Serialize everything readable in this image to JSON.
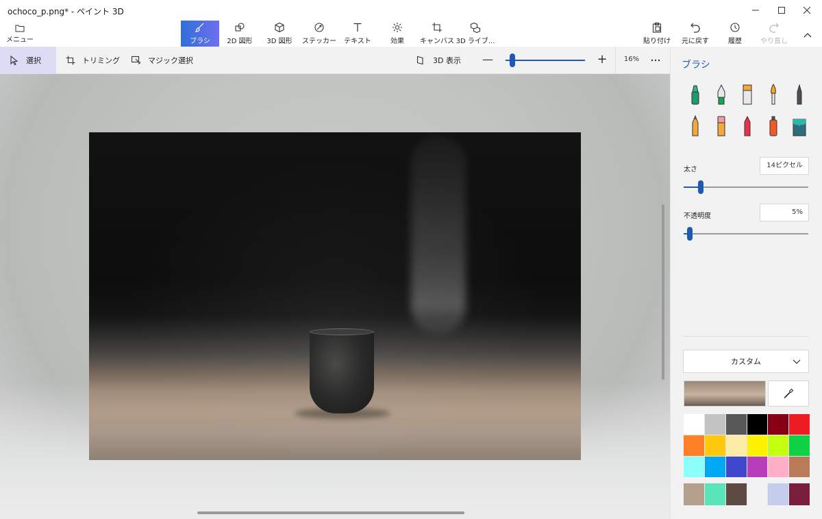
{
  "window": {
    "title": "ochoco_p.png* - ペイント 3D"
  },
  "ribbon": {
    "menu_label": "メニュー",
    "tools": [
      {
        "label": "ブラシ",
        "icon": "brush-icon",
        "active": true
      },
      {
        "label": "2D 図形",
        "icon": "2d-shapes-icon"
      },
      {
        "label": "3D 図形",
        "icon": "3d-shapes-icon"
      },
      {
        "label": "ステッカー",
        "icon": "sticker-icon"
      },
      {
        "label": "テキスト",
        "icon": "text-icon"
      },
      {
        "label": "効果",
        "icon": "effects-icon"
      },
      {
        "label": "キャンバス",
        "icon": "canvas-icon"
      },
      {
        "label": "3D ライブ...",
        "icon": "3d-library-icon"
      }
    ],
    "actions": [
      {
        "label": "貼り付け",
        "icon": "paste-icon"
      },
      {
        "label": "元に戻す",
        "icon": "undo-icon"
      },
      {
        "label": "履歴",
        "icon": "history-icon"
      },
      {
        "label": "やり直し",
        "icon": "redo-icon",
        "disabled": true
      }
    ]
  },
  "subbar": {
    "select_label": "選択",
    "trim_label": "トリミング",
    "magic_label": "マジック選択",
    "view3d_label": "3D 表示",
    "zoom_percent": "16%",
    "zoom_level": 0.05
  },
  "panel": {
    "title": "ブラシ",
    "thickness_label": "太さ",
    "thickness_value": "14ピクセル",
    "thickness_level": 0.14,
    "opacity_label": "不透明度",
    "opacity_value": "5%",
    "opacity_level": 0.05,
    "palette_mode": "カスタム",
    "accent": "#1e5ab3",
    "palette": [
      "#ffffff",
      "#c3c3c3",
      "#585858",
      "#000000",
      "#880015",
      "#ed1c24",
      "#ff7f27",
      "#ffc90e",
      "#fdeca6",
      "#fff200",
      "#c4ff0e",
      "#0ed145",
      "#8cfffb",
      "#00a8f3",
      "#3f48cc",
      "#b83dba",
      "#ffaec8",
      "#b97a57"
    ],
    "custom_palette": [
      "#b4a08c",
      "#5ae5b8",
      "#5e4a40",
      "#f2f2f2",
      "#c6ccec",
      "#7a1e3e"
    ]
  }
}
